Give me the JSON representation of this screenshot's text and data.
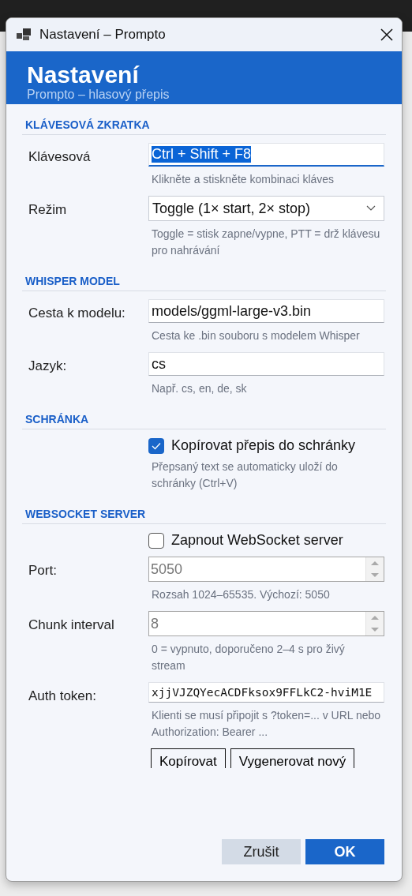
{
  "window": {
    "title": "Nastavení – Prompto"
  },
  "header": {
    "title": "Nastavení",
    "subtitle": "Prompto – hlasový přepis"
  },
  "sections": [
    {
      "heading": "KLÁVESOVÁ ZKRATKA",
      "rows": [
        {
          "kind": "text",
          "label": "Klávesová",
          "value": "Ctrl + Shift + F8",
          "focused": true,
          "hint": "Klikněte a stiskněte kombinaci kláves"
        },
        {
          "kind": "select",
          "label": "Režim",
          "value": "Toggle (1× start, 2× stop)",
          "hint": "Toggle = stisk zapne/vypne, PTT = drž klávesu pro nahrávání"
        }
      ]
    },
    {
      "heading": "WHISPER MODEL",
      "rows": [
        {
          "kind": "text",
          "label": "Cesta k modelu:",
          "value": "models/ggml-large-v3.bin",
          "focused": false,
          "hint": "Cesta ke .bin souboru s modelem Whisper"
        },
        {
          "kind": "text",
          "label": "Jazyk:",
          "value": "cs",
          "focused": false,
          "hint": "Např. cs, en, de, sk"
        }
      ]
    },
    {
      "heading": "SCHRÁNKA",
      "rows": [
        {
          "kind": "checkbox",
          "label": "Kopírovat přepis do schránky",
          "checked": true,
          "hint": "Přepsaný text se automaticky uloží do schránky (Ctrl+V)"
        }
      ]
    },
    {
      "heading": "WEBSOCKET SERVER",
      "rows": [
        {
          "kind": "checkbox",
          "label": "Zapnout WebSocket server",
          "checked": false
        },
        {
          "kind": "spin",
          "label": "Port:",
          "value": "5050",
          "disabled": true,
          "hint": "Rozsah 1024–65535. Výchozí: 5050"
        },
        {
          "kind": "spin",
          "label": "Chunk interval",
          "value": "8",
          "disabled": true,
          "hint": "0 = vypnuto, doporučeno 2–4 s pro živý stream"
        },
        {
          "kind": "token",
          "label": "Auth token:",
          "value": "xjjVJZQYecACDFksox9FFLkC2-hviM1E",
          "hint": "Klienti se musí připojit s ?token=... v URL nebo Authorization: Bearer ...",
          "buttons": [
            "Kopírovat",
            "Vygenerovat nový"
          ]
        }
      ]
    }
  ],
  "footer": [
    {
      "label": "Zrušit",
      "kind": "secondary"
    },
    {
      "label": "OK",
      "kind": "primary"
    }
  ]
}
